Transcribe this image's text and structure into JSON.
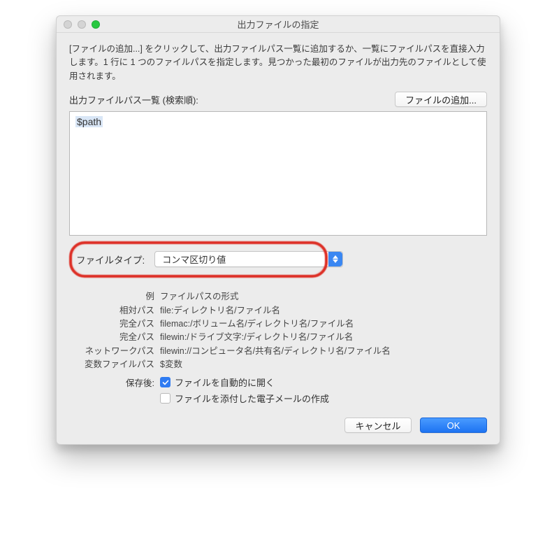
{
  "window": {
    "title": "出力ファイルの指定"
  },
  "instructions": "[ファイルの追加...] をクリックして、出力ファイルパス一覧に追加するか、一覧にファイルパスを直接入力します。1 行に 1 つのファイルパスを指定します。見つかった最初のファイルが出力先のファイルとして使用されます。",
  "path_list": {
    "label": "出力ファイルパス一覧 (検索順):",
    "add_button": "ファイルの追加...",
    "value": "$path"
  },
  "file_type": {
    "label": "ファイルタイプ:",
    "selected": "コンマ区切り値"
  },
  "examples": {
    "header_label": "例",
    "header_value": "ファイルパスの形式",
    "rows": [
      {
        "label": "相対パス",
        "value": "file:ディレクトリ名/ファイル名"
      },
      {
        "label": "完全パス",
        "value": "filemac:/ボリューム名/ディレクトリ名/ファイル名"
      },
      {
        "label": "完全パス",
        "value": "filewin:/ドライブ文字:/ディレクトリ名/ファイル名"
      },
      {
        "label": "ネットワークパス",
        "value": "filewin://コンピュータ名/共有名/ディレクトリ名/ファイル名"
      },
      {
        "label": "変数ファイルパス",
        "value": "$変数"
      }
    ]
  },
  "after_save": {
    "label": "保存後:",
    "open_file": {
      "label": "ファイルを自動的に開く",
      "checked": true
    },
    "email_attach": {
      "label": "ファイルを添付した電子メールの作成",
      "checked": false
    }
  },
  "footer": {
    "cancel": "キャンセル",
    "ok": "OK"
  },
  "highlight": {
    "color": "#d9342b"
  }
}
